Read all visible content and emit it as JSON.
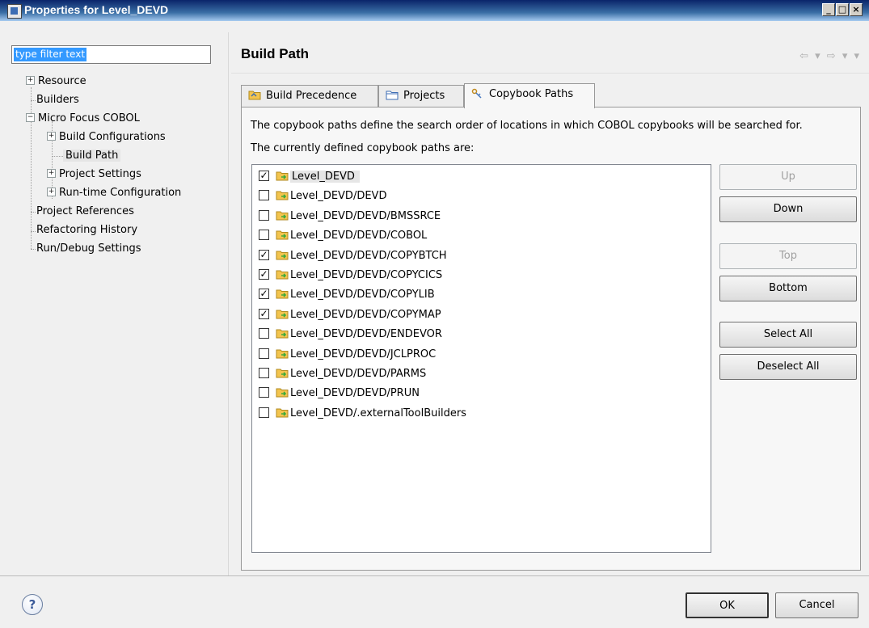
{
  "window": {
    "title": "Properties for Level_DEVD",
    "controls": [
      "_",
      "□",
      "×"
    ]
  },
  "filter": {
    "value": "type filter text"
  },
  "tree": [
    {
      "label": "Resource",
      "expander": "+"
    },
    {
      "label": "Builders",
      "expander": ""
    },
    {
      "label": "Micro Focus COBOL",
      "expander": "−"
    },
    {
      "label": "Build Configurations",
      "expander": "+"
    },
    {
      "label": "Build Path",
      "expander": ""
    },
    {
      "label": "Project Settings",
      "expander": "+"
    },
    {
      "label": "Run-time Configuration",
      "expander": "+"
    },
    {
      "label": "Project References",
      "expander": ""
    },
    {
      "label": "Refactoring History",
      "expander": ""
    },
    {
      "label": "Run/Debug Settings",
      "expander": ""
    }
  ],
  "page": {
    "title": "Build Path",
    "nav": "⇦ ▾ ⇨ ▾ ▾"
  },
  "tabs": [
    "Build Precedence",
    "Projects",
    "Copybook Paths"
  ],
  "description": "The copybook paths define the search order of locations in which COBOL copybooks will be searched for.",
  "list_caption": "The currently defined copybook paths are:",
  "paths": [
    {
      "label": "Level_DEVD",
      "checked": true
    },
    {
      "label": "Level_DEVD/DEVD",
      "checked": false
    },
    {
      "label": "Level_DEVD/DEVD/BMSSRCE",
      "checked": false
    },
    {
      "label": "Level_DEVD/DEVD/COBOL",
      "checked": false
    },
    {
      "label": "Level_DEVD/DEVD/COPYBTCH",
      "checked": true
    },
    {
      "label": "Level_DEVD/DEVD/COPYCICS",
      "checked": true
    },
    {
      "label": "Level_DEVD/DEVD/COPYLIB",
      "checked": true
    },
    {
      "label": "Level_DEVD/DEVD/COPYMAP",
      "checked": true
    },
    {
      "label": "Level_DEVD/DEVD/ENDEVOR",
      "checked": false
    },
    {
      "label": "Level_DEVD/DEVD/JCLPROC",
      "checked": false
    },
    {
      "label": "Level_DEVD/DEVD/PARMS",
      "checked": false
    },
    {
      "label": "Level_DEVD/DEVD/PRUN",
      "checked": false
    },
    {
      "label": "Level_DEVD/.externalToolBuilders",
      "checked": false
    }
  ],
  "buttons": {
    "up": "Up",
    "down": "Down",
    "top": "Top",
    "bottom": "Bottom",
    "select_all": "Select All",
    "deselect_all": "Deselect All"
  },
  "footer": {
    "help": "?",
    "ok": "OK",
    "cancel": "Cancel"
  },
  "colors": {
    "titlebar": "#0a246a",
    "selection": "#3399ff",
    "folder": "#f3c44e",
    "folder_arrow": "#3caa3c"
  }
}
